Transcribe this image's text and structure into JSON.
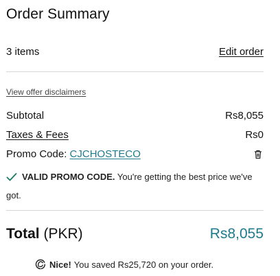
{
  "summary": {
    "title": "Order Summary",
    "items_count": "3 items",
    "edit_order": "Edit order",
    "disclaimers": "View offer disclaimers"
  },
  "lines": {
    "subtotal_label": "Subtotal",
    "subtotal_value": "Rs8,055",
    "taxes_label": "Taxes & Fees",
    "taxes_value": "Rs0",
    "promo_label": "Promo Code: ",
    "promo_code": "CJCHOSTECO"
  },
  "promo_status": {
    "strong": "VALID PROMO CODE.",
    "message": " You're getting the best price we've got."
  },
  "total": {
    "label": "Total ",
    "currency": "(PKR)",
    "value": "Rs8,055"
  },
  "savings": {
    "strong": "Nice!",
    "message": "You saved Rs25,720 on your order."
  },
  "colors": {
    "accent": "#1f7a8c",
    "check": "#1a7a66",
    "divider": "#d6d6d6"
  },
  "icons": [
    "trash-icon",
    "check-icon",
    "logo-icon"
  ]
}
